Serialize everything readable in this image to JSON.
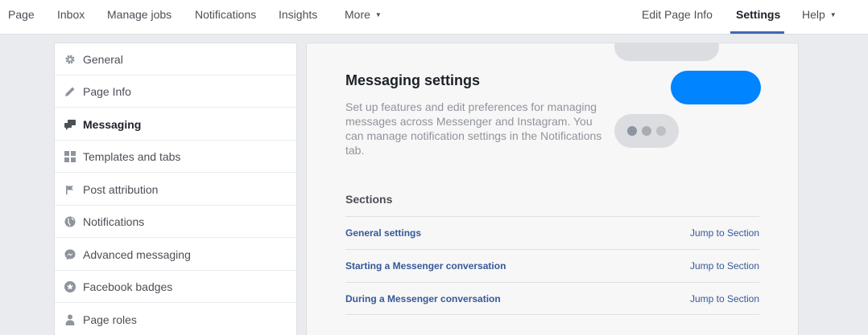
{
  "topnav": {
    "left": [
      "Page",
      "Inbox",
      "Manage jobs",
      "Notifications",
      "Insights",
      "More"
    ],
    "right": [
      "Edit Page Info",
      "Settings",
      "Help"
    ],
    "active": "Settings",
    "accent": "#4267b2"
  },
  "sidebar": {
    "items": [
      {
        "label": "General",
        "icon": "gear-icon"
      },
      {
        "label": "Page Info",
        "icon": "pencil-icon"
      },
      {
        "label": "Messaging",
        "icon": "chat-bubbles-icon",
        "active": true
      },
      {
        "label": "Templates and tabs",
        "icon": "grid-icon"
      },
      {
        "label": "Post attribution",
        "icon": "flag-icon"
      },
      {
        "label": "Notifications",
        "icon": "globe-icon"
      },
      {
        "label": "Advanced messaging",
        "icon": "messenger-icon"
      },
      {
        "label": "Facebook badges",
        "icon": "star-badge-icon"
      },
      {
        "label": "Page roles",
        "icon": "person-icon"
      }
    ]
  },
  "main": {
    "title": "Messaging settings",
    "description": "Set up features and edit preferences for managing messages across Messenger and Instagram. You can manage notification settings in the Notifications tab.",
    "sections_title": "Sections",
    "sections": [
      {
        "name": "General settings",
        "jump": "Jump to Section"
      },
      {
        "name": "Starting a Messenger conversation",
        "jump": "Jump to Section"
      },
      {
        "name": "During a Messenger conversation",
        "jump": "Jump to Section"
      }
    ],
    "illustration": {
      "bubble_color": "#0084ff",
      "grey_color": "#dcdde0"
    }
  }
}
